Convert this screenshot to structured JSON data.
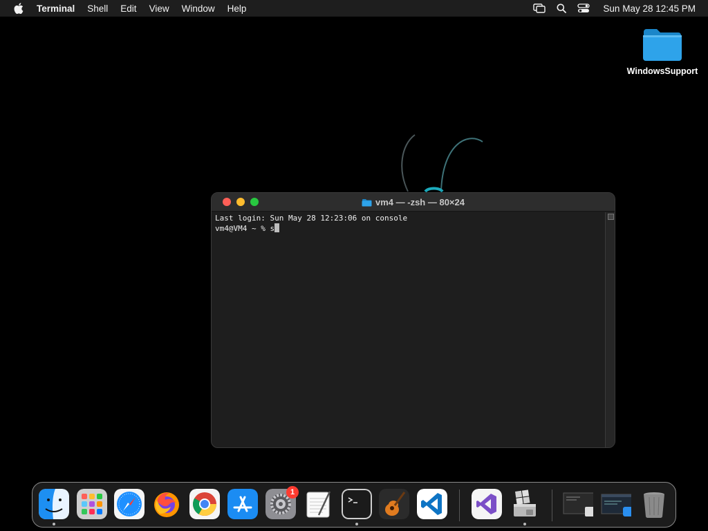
{
  "menubar": {
    "app_name": "Terminal",
    "items": [
      "Shell",
      "Edit",
      "View",
      "Window",
      "Help"
    ],
    "clock": "Sun May 28  12:45 PM"
  },
  "desktop": {
    "folder_label": "WindowsSupport"
  },
  "terminal": {
    "title": "vm4 — -zsh — 80×24",
    "lines": [
      "Last login: Sun May 28 12:23:06 on console",
      "vm4@VM4 ~ % s"
    ]
  },
  "dock": {
    "apps": [
      "finder-icon",
      "launchpad-icon",
      "safari-icon",
      "firefox-icon",
      "chrome-icon",
      "app-store-icon",
      "system-settings-icon",
      "textedit-icon",
      "terminal-icon",
      "garageband-icon",
      "vscode-icon",
      "visual-studio-icon",
      "boot-camp-icon",
      "recent-window-1",
      "recent-window-2",
      "trash-icon"
    ],
    "settings_badge": "1"
  },
  "colors": {
    "close": "#fe5f57",
    "minimize": "#febc2e",
    "zoom": "#28c840",
    "folder": "#2ea3ea"
  }
}
